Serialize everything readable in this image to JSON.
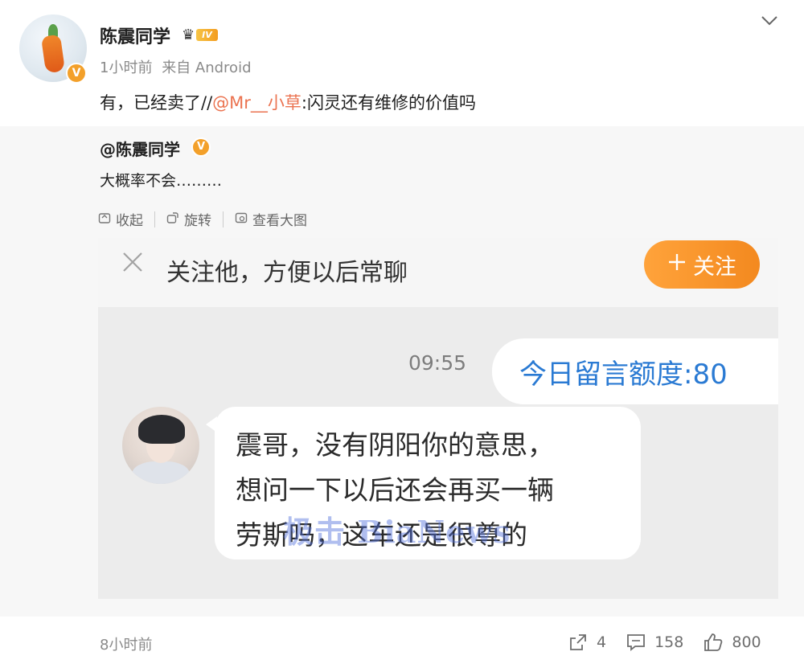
{
  "post": {
    "username": "陈震同学",
    "vip_level": "IV",
    "time": "1小时前",
    "source": "来自 Android",
    "text_prefix": "有，已经卖了//",
    "mention": "@Mr__小草",
    "text_suffix": ":闪灵还有维修的价值吗"
  },
  "retweet": {
    "user": "@陈震同学",
    "text": "大概率不会………",
    "toolbar": [
      "收起",
      "旋转",
      "查看大图"
    ]
  },
  "screenshot": {
    "follow_tip": "关注他，方便以后常聊",
    "follow_btn": "关注",
    "time": "09:55",
    "quota": "今日留言额度:80",
    "message_lines": [
      "震哥，没有阴阳你的意思，",
      "想问一下以后还会再买一辆",
      "劳斯吗，这车还是很尊的"
    ],
    "watermark": "极击 BiaNews"
  },
  "footer": {
    "time": "8小时前",
    "reposts": "4",
    "comments": "158",
    "likes": "800"
  },
  "colors": {
    "accent": "#eb7350",
    "follow": "#f3891f",
    "quota_text": "#2a7ad3"
  },
  "icons": [
    "chevron-down-icon",
    "verified-icon",
    "crown-icon",
    "collapse-icon",
    "rotate-icon",
    "view-large-icon",
    "close-icon",
    "share-icon",
    "comment-icon",
    "like-icon"
  ]
}
